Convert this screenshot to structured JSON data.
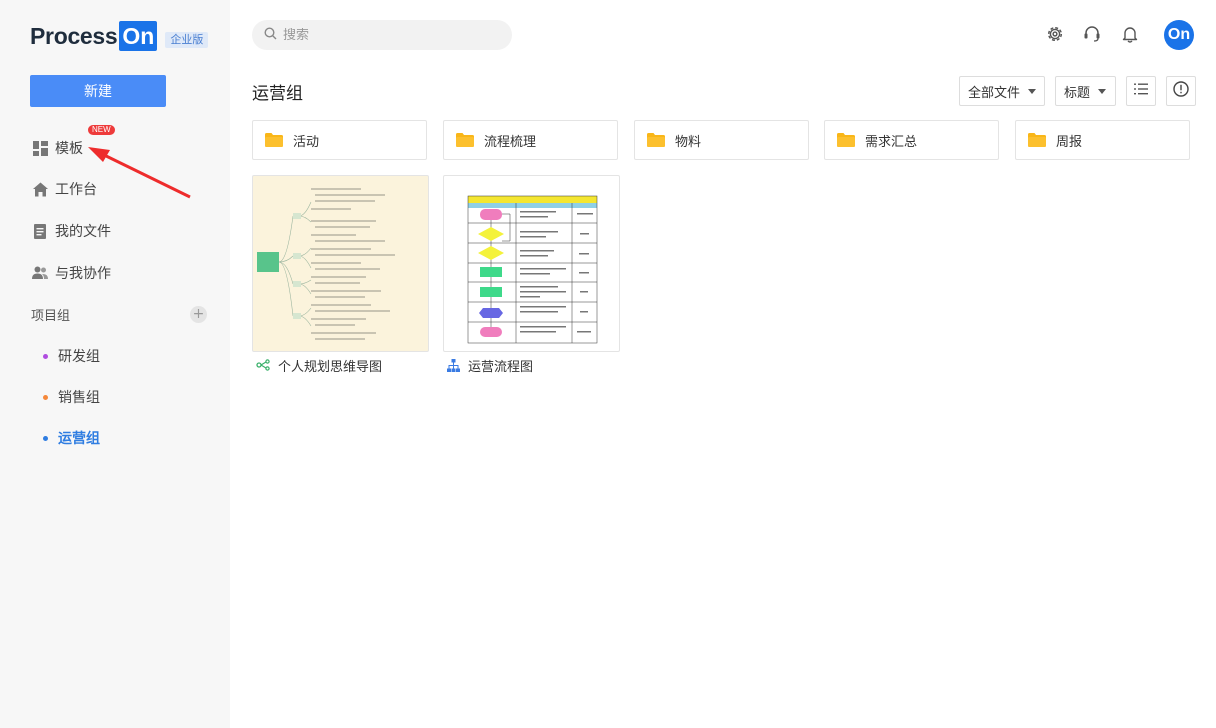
{
  "brand": {
    "name_part1": "Process",
    "name_part2": "On",
    "edition": "企业版"
  },
  "sidebar": {
    "new_button": "新建",
    "nav": [
      {
        "label": "模板",
        "icon": "template-icon",
        "badge": "NEW"
      },
      {
        "label": "工作台",
        "icon": "home-icon"
      },
      {
        "label": "我的文件",
        "icon": "file-icon"
      },
      {
        "label": "与我协作",
        "icon": "collaborate-icon"
      }
    ],
    "groups_title": "项目组",
    "groups_add": "+",
    "groups": [
      {
        "label": "研发组",
        "color": "#b04de0"
      },
      {
        "label": "销售组",
        "color": "#f5883a"
      },
      {
        "label": "运营组",
        "color": "#2f7de1",
        "active": true
      }
    ]
  },
  "header": {
    "search_placeholder": "搜索",
    "avatar_text": "On"
  },
  "main": {
    "title": "运营组",
    "filter": "全部文件",
    "sort": "标题",
    "folders": [
      {
        "name": "活动"
      },
      {
        "name": "流程梳理"
      },
      {
        "name": "物料"
      },
      {
        "name": "需求汇总"
      },
      {
        "name": "周报"
      }
    ],
    "files": [
      {
        "name": "个人规划思维导图",
        "type_icon": "mindmap-icon"
      },
      {
        "name": "运营流程图",
        "type_icon": "flowchart-icon"
      }
    ]
  },
  "colors": {
    "accent": "#4a8cf7",
    "brand": "#1a73e8",
    "folder": "#f9b618",
    "new_badge": "#ee3b3b"
  }
}
